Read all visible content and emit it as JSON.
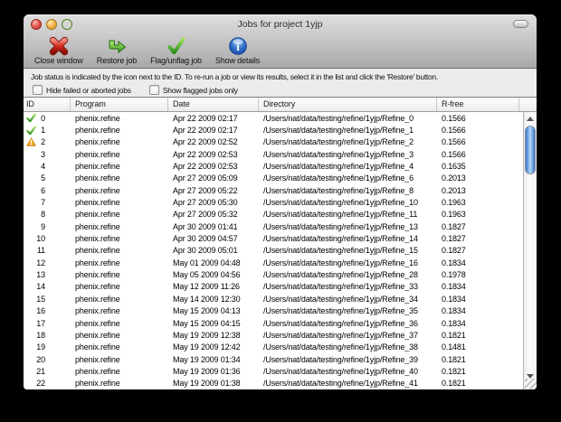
{
  "window": {
    "title": "Jobs for project 1yjp"
  },
  "toolbar": {
    "items": [
      {
        "label": "Close window",
        "icon": "close-x-icon"
      },
      {
        "label": "Restore job",
        "icon": "restore-arrow-icon"
      },
      {
        "label": "Flag/unflag job",
        "icon": "flag-check-icon"
      },
      {
        "label": "Show details",
        "icon": "info-icon"
      }
    ]
  },
  "info_text": "Job status is indicated by the icon next to the ID. To re-run a job or view its results, select it in the list and click the 'Restore' button.",
  "filters": [
    {
      "label": "Hide failed or aborted jobs",
      "checked": false
    },
    {
      "label": "Show flagged jobs only",
      "checked": false
    }
  ],
  "table": {
    "columns": [
      "ID",
      "Program",
      "Date",
      "Directory",
      "R-free"
    ],
    "rows": [
      {
        "id": "0",
        "status": "success",
        "program": "phenix.refine",
        "date": "Apr 22 2009 02:17",
        "directory": "/Users/nat/data/testing/refine/1yjp/Refine_0",
        "rfree": "0.1566"
      },
      {
        "id": "1",
        "status": "success",
        "program": "phenix.refine",
        "date": "Apr 22 2009 02:17",
        "directory": "/Users/nat/data/testing/refine/1yjp/Refine_1",
        "rfree": "0.1566"
      },
      {
        "id": "2",
        "status": "warning",
        "program": "phenix.refine",
        "date": "Apr 22 2009 02:52",
        "directory": "/Users/nat/data/testing/refine/1yjp/Refine_2",
        "rfree": "0.1566"
      },
      {
        "id": "3",
        "status": "none",
        "program": "phenix.refine",
        "date": "Apr 22 2009 02:53",
        "directory": "/Users/nat/data/testing/refine/1yjp/Refine_3",
        "rfree": "0.1566"
      },
      {
        "id": "4",
        "status": "none",
        "program": "phenix.refine",
        "date": "Apr 22 2009 02:53",
        "directory": "/Users/nat/data/testing/refine/1yjp/Refine_4",
        "rfree": "0.1635"
      },
      {
        "id": "5",
        "status": "none",
        "program": "phenix.refine",
        "date": "Apr 27 2009 05:09",
        "directory": "/Users/nat/data/testing/refine/1yjp/Refine_6",
        "rfree": "0.2013"
      },
      {
        "id": "6",
        "status": "none",
        "program": "phenix.refine",
        "date": "Apr 27 2009 05:22",
        "directory": "/Users/nat/data/testing/refine/1yjp/Refine_8",
        "rfree": "0.2013"
      },
      {
        "id": "7",
        "status": "none",
        "program": "phenix.refine",
        "date": "Apr 27 2009 05:30",
        "directory": "/Users/nat/data/testing/refine/1yjp/Refine_10",
        "rfree": "0.1963"
      },
      {
        "id": "8",
        "status": "none",
        "program": "phenix.refine",
        "date": "Apr 27 2009 05:32",
        "directory": "/Users/nat/data/testing/refine/1yjp/Refine_11",
        "rfree": "0.1963"
      },
      {
        "id": "9",
        "status": "none",
        "program": "phenix.refine",
        "date": "Apr 30 2009 01:41",
        "directory": "/Users/nat/data/testing/refine/1yjp/Refine_13",
        "rfree": "0.1827"
      },
      {
        "id": "10",
        "status": "none",
        "program": "phenix.refine",
        "date": "Apr 30 2009 04:57",
        "directory": "/Users/nat/data/testing/refine/1yjp/Refine_14",
        "rfree": "0.1827"
      },
      {
        "id": "11",
        "status": "none",
        "program": "phenix.refine",
        "date": "Apr 30 2009 05:01",
        "directory": "/Users/nat/data/testing/refine/1yjp/Refine_15",
        "rfree": "0.1827"
      },
      {
        "id": "12",
        "status": "none",
        "program": "phenix.refine",
        "date": "May 01 2009 04:48",
        "directory": "/Users/nat/data/testing/refine/1yjp/Refine_16",
        "rfree": "0.1834"
      },
      {
        "id": "13",
        "status": "none",
        "program": "phenix.refine",
        "date": "May 05 2009 04:56",
        "directory": "/Users/nat/data/testing/refine/1yjp/Refine_28",
        "rfree": "0.1978"
      },
      {
        "id": "14",
        "status": "none",
        "program": "phenix.refine",
        "date": "May 12 2009 11:26",
        "directory": "/Users/nat/data/testing/refine/1yjp/Refine_33",
        "rfree": "0.1834"
      },
      {
        "id": "15",
        "status": "none",
        "program": "phenix.refine",
        "date": "May 14 2009 12:30",
        "directory": "/Users/nat/data/testing/refine/1yjp/Refine_34",
        "rfree": "0.1834"
      },
      {
        "id": "16",
        "status": "none",
        "program": "phenix.refine",
        "date": "May 15 2009 04:13",
        "directory": "/Users/nat/data/testing/refine/1yjp/Refine_35",
        "rfree": "0.1834"
      },
      {
        "id": "17",
        "status": "none",
        "program": "phenix.refine",
        "date": "May 15 2009 04:15",
        "directory": "/Users/nat/data/testing/refine/1yjp/Refine_36",
        "rfree": "0.1834"
      },
      {
        "id": "18",
        "status": "none",
        "program": "phenix.refine",
        "date": "May 19 2009 12:38",
        "directory": "/Users/nat/data/testing/refine/1yjp/Refine_37",
        "rfree": "0.1821"
      },
      {
        "id": "19",
        "status": "none",
        "program": "phenix.refine",
        "date": "May 19 2009 12:42",
        "directory": "/Users/nat/data/testing/refine/1yjp/Refine_38",
        "rfree": "0.1481"
      },
      {
        "id": "20",
        "status": "none",
        "program": "phenix.refine",
        "date": "May 19 2009 01:34",
        "directory": "/Users/nat/data/testing/refine/1yjp/Refine_39",
        "rfree": "0.1821"
      },
      {
        "id": "21",
        "status": "none",
        "program": "phenix.refine",
        "date": "May 19 2009 01:36",
        "directory": "/Users/nat/data/testing/refine/1yjp/Refine_40",
        "rfree": "0.1821"
      },
      {
        "id": "22",
        "status": "none",
        "program": "phenix.refine",
        "date": "May 19 2009 01:38",
        "directory": "/Users/nat/data/testing/refine/1yjp/Refine_41",
        "rfree": "0.1821"
      }
    ]
  },
  "colors": {
    "success": "#2ea12c",
    "warning": "#f5a623",
    "close_red": "#c61f12",
    "scrollbar_thumb": "#6fa5e3"
  }
}
